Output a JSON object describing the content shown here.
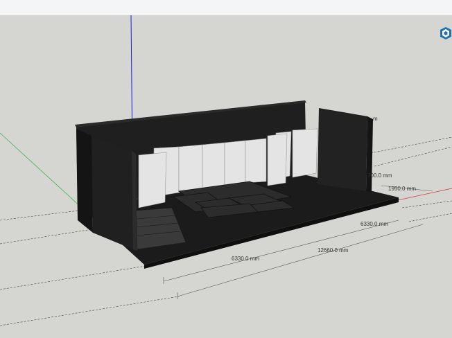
{
  "app": {
    "logo_icon": "sketchup-logo-icon"
  },
  "colors": {
    "background": "#d5d5d1",
    "toolbar": "#f4f5f7",
    "model_dark": "#1e1e1e",
    "model_mid": "#2d2d2d",
    "panel_light": "#e6e6e6",
    "axis_blue": "#1a1adc",
    "axis_green": "#3fae5a",
    "axis_red": "#d43a3a",
    "accent_logo": "#1f6fb5"
  },
  "dimensions": {
    "width_total": "12660.0 mm",
    "width_left": "6330.0 mm",
    "width_right": "6330.0 mm",
    "depth_a": "700.0 mm",
    "depth_b": "1950.0 mm",
    "partial_label": "m"
  }
}
